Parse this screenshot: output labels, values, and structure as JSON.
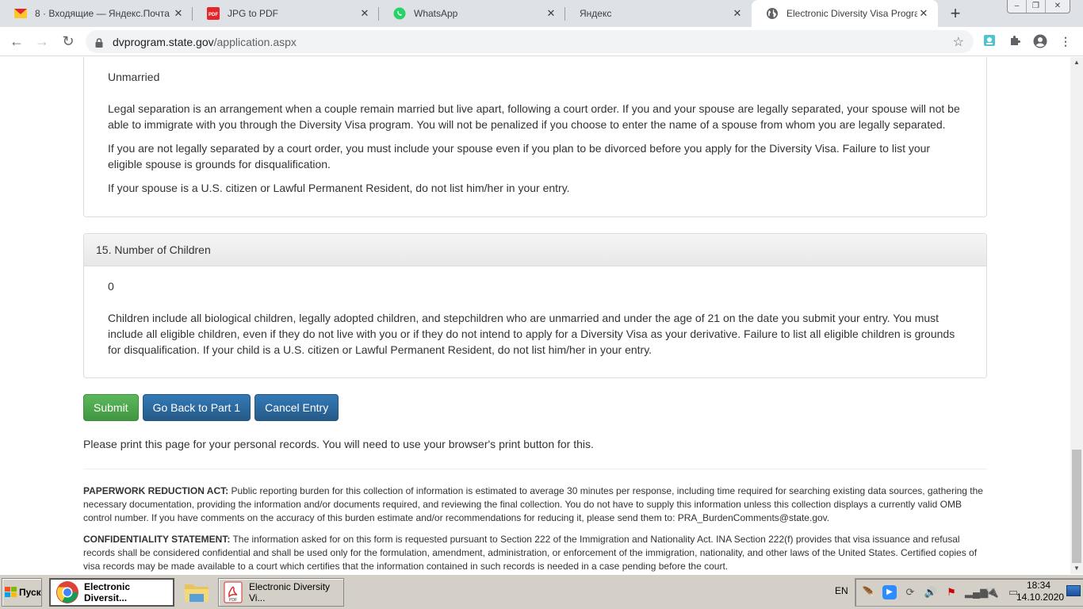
{
  "browser": {
    "tabs": [
      {
        "title": "8 · Входящие — Яндекс.Почта",
        "icon": "yandex-mail-icon",
        "active": false
      },
      {
        "title": "JPG to PDF",
        "icon": "pdf-icon",
        "active": false
      },
      {
        "title": "WhatsApp",
        "icon": "whatsapp-icon",
        "active": false
      },
      {
        "title": "Яндекс",
        "icon": "blank-icon",
        "active": false
      },
      {
        "title": "Electronic Diversity Visa Program",
        "icon": "globe-icon",
        "active": true
      }
    ],
    "new_tab_label": "+",
    "url_host": "dvprogram.state.gov",
    "url_path": "/application.aspx",
    "window_controls": {
      "minimize": "–",
      "restore": "❐",
      "close": "✕"
    }
  },
  "page": {
    "marital_panel": {
      "value": "Unmarried",
      "paragraphs": [
        "Legal separation is an arrangement when a couple remain married but live apart, following a court order. If you and your spouse are legally separated, your spouse will not be able to immigrate with you through the Diversity Visa program. You will not be penalized if you choose to enter the name of a spouse from whom you are legally separated.",
        "If you are not legally separated by a court order, you must include your spouse even if you plan to be divorced before you apply for the Diversity Visa. Failure to list your eligible spouse is grounds for disqualification.",
        "If your spouse is a U.S. citizen or Lawful Permanent Resident, do not list him/her in your entry."
      ]
    },
    "children_panel": {
      "heading": "15. Number of Children",
      "value": "0",
      "paragraphs": [
        "Children include all biological children, legally adopted children, and stepchildren who are unmarried and under the age of 21 on the date you submit your entry. You must include all eligible children, even if they do not live with you or if they do not intend to apply for a Diversity Visa as your derivative. Failure to list all eligible children is grounds for disqualification. If your child is a U.S. citizen or Lawful Permanent Resident, do not list him/her in your entry."
      ]
    },
    "buttons": {
      "submit": "Submit",
      "go_back": "Go Back to Part 1",
      "cancel": "Cancel Entry"
    },
    "print_note": "Please print this page for your personal records. You will need to use your browser's print button for this.",
    "paperwork": {
      "label": "PAPERWORK REDUCTION ACT:",
      "text": " Public reporting burden for this collection of information is estimated to average 30 minutes per response, including time required for searching existing data sources, gathering the necessary documentation, providing the information and/or documents required, and reviewing the final collection. You do not have to supply this information unless this collection displays a currently valid OMB control number. If you have comments on the accuracy of this burden estimate and/or recommendations for reducing it, please send them to: PRA_BurdenComments@state.gov."
    },
    "confidentiality": {
      "label": "CONFIDENTIALITY STATEMENT:",
      "text": " The information asked for on this form is requested pursuant to Section 222 of the Immigration and Nationality Act. INA Section 222(f) provides that visa issuance and refusal records shall be considered confidential and shall be used only for the formulation, amendment, administration, or enforcement of the immigration, nationality, and other laws of the United States. Certified copies of visa records may be made available to a court which certifies that the information contained in such records is needed in a case pending before the court."
    }
  },
  "taskbar": {
    "start_label": "Пуск",
    "tasks": [
      {
        "label": "Electronic Diversit...",
        "icon": "chrome-icon",
        "active": true
      },
      {
        "label": "",
        "icon": "file-explorer-icon",
        "active": false
      },
      {
        "label": "Electronic Diversity Vi...",
        "icon": "pdf-reader-icon",
        "active": false
      }
    ],
    "language": "EN",
    "time": "18:34",
    "date": "14.10.2020"
  },
  "colors": {
    "submit": "#5cb85c",
    "primary": "#337ab7"
  }
}
